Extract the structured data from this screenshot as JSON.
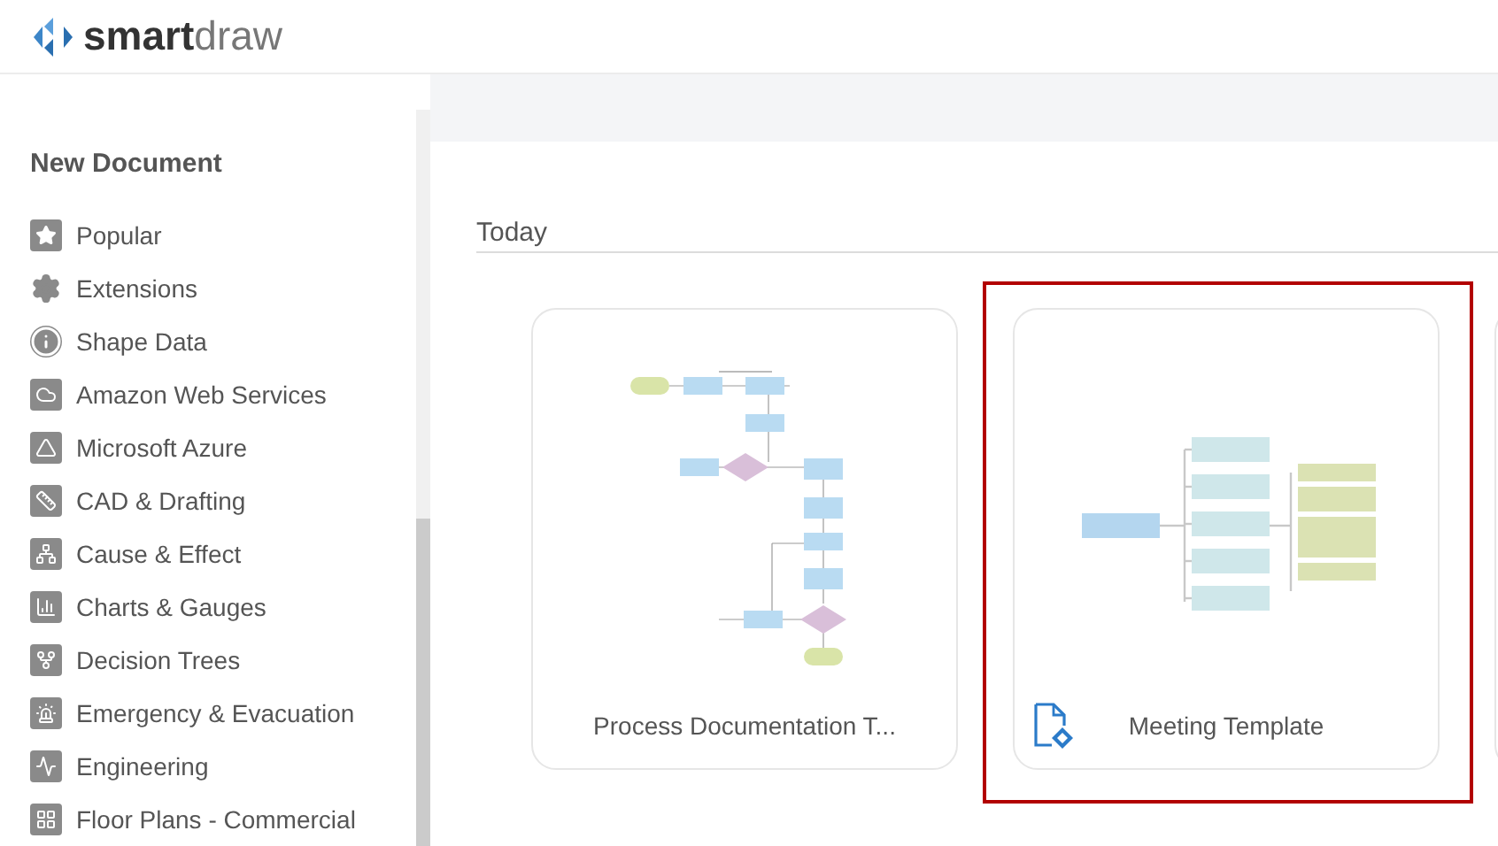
{
  "header": {
    "logo_text": "**smart**draw"
  },
  "sidebar": {
    "title": "New Document",
    "items": [
      {
        "label": "Popular",
        "kind": "star"
      },
      {
        "label": "Extensions",
        "kind": "gear"
      },
      {
        "label": "Shape Data",
        "kind": "info"
      },
      {
        "label": "Amazon Web Services",
        "kind": "cloud"
      },
      {
        "label": "Microsoft Azure",
        "kind": "triangle"
      },
      {
        "label": "CAD & Drafting",
        "kind": "square-ruler"
      },
      {
        "label": "Cause & Effect",
        "kind": "fishbone"
      },
      {
        "label": "Charts & Gauges",
        "kind": "bars"
      },
      {
        "label": "Decision Trees",
        "kind": "tree"
      },
      {
        "label": "Emergency & Evacuation",
        "kind": "alarm"
      },
      {
        "label": "Engineering",
        "kind": "wave"
      },
      {
        "label": "Floor Plans - Commercial",
        "kind": "floorplan"
      }
    ]
  },
  "section": {
    "title": "Today"
  },
  "templates": [
    {
      "title": "Process Documentation T...",
      "kind": "flowchart",
      "selected": false,
      "file_icon": false
    },
    {
      "title": "Meeting Template",
      "kind": "mindmap",
      "selected": true,
      "file_icon": true
    }
  ]
}
